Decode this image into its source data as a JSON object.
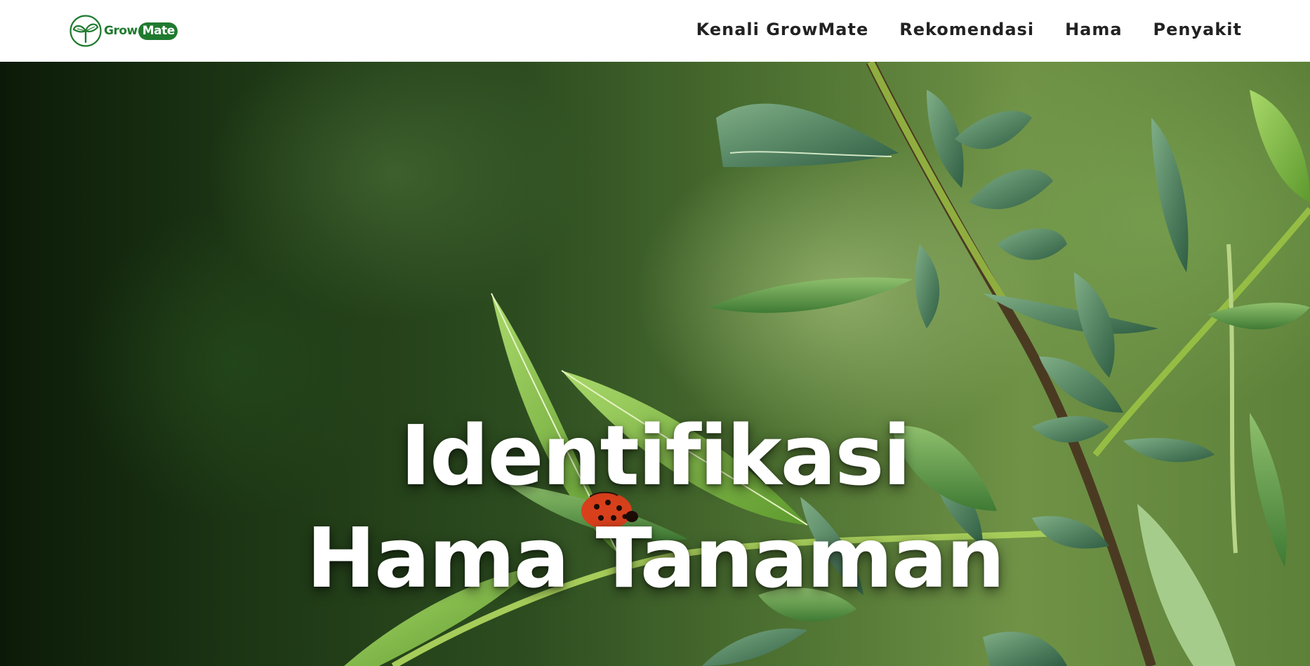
{
  "brand": {
    "name_part1": "Grow",
    "name_part2": "Mate",
    "logo_icon": "sprout-icon",
    "primary_color": "#1f7a2e"
  },
  "nav": {
    "items": [
      {
        "label": "Kenali GrowMate"
      },
      {
        "label": "Rekomendasi"
      },
      {
        "label": "Hama"
      },
      {
        "label": "Penyakit"
      }
    ]
  },
  "hero": {
    "title_line1": "Identifikasi",
    "title_line2": "Hama Tanaman",
    "background_image": "ladybug-on-leaves-photo"
  }
}
